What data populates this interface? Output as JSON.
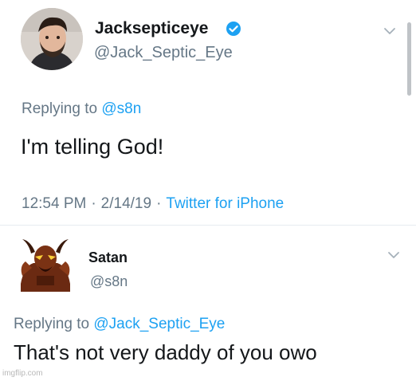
{
  "tweet_main": {
    "display_name": "Jacksepticeye",
    "handle": "@Jack_Septic_Eye",
    "replying_prefix": "Replying to",
    "replying_mention": "@s8n",
    "text": "I'm telling God!",
    "time": "12:54 PM",
    "date": "2/14/19",
    "source": "Twitter for iPhone",
    "separator": "·",
    "verified_icon": "verified-badge-icon",
    "accent_color": "#1da1f2"
  },
  "tweet_reply": {
    "display_name": "Satan",
    "handle": "@s8n",
    "replying_prefix": "Replying to",
    "replying_mention": "@Jack_Septic_Eye",
    "text": "That's not very daddy of you owo"
  },
  "watermark": "imgflip.com"
}
